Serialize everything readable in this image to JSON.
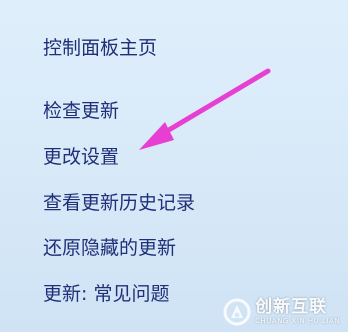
{
  "nav": {
    "home": "控制面板主页",
    "check_updates": "检查更新",
    "change_settings": "更改设置",
    "view_history": "查看更新历史记录",
    "restore_hidden": "还原隐藏的更新",
    "faq": "更新: 常见问题"
  },
  "annotation": {
    "arrow_color": "#e83fd3"
  },
  "watermark": {
    "name": "创新互联",
    "subtitle": "CHUANG XIN HU LIAN"
  }
}
